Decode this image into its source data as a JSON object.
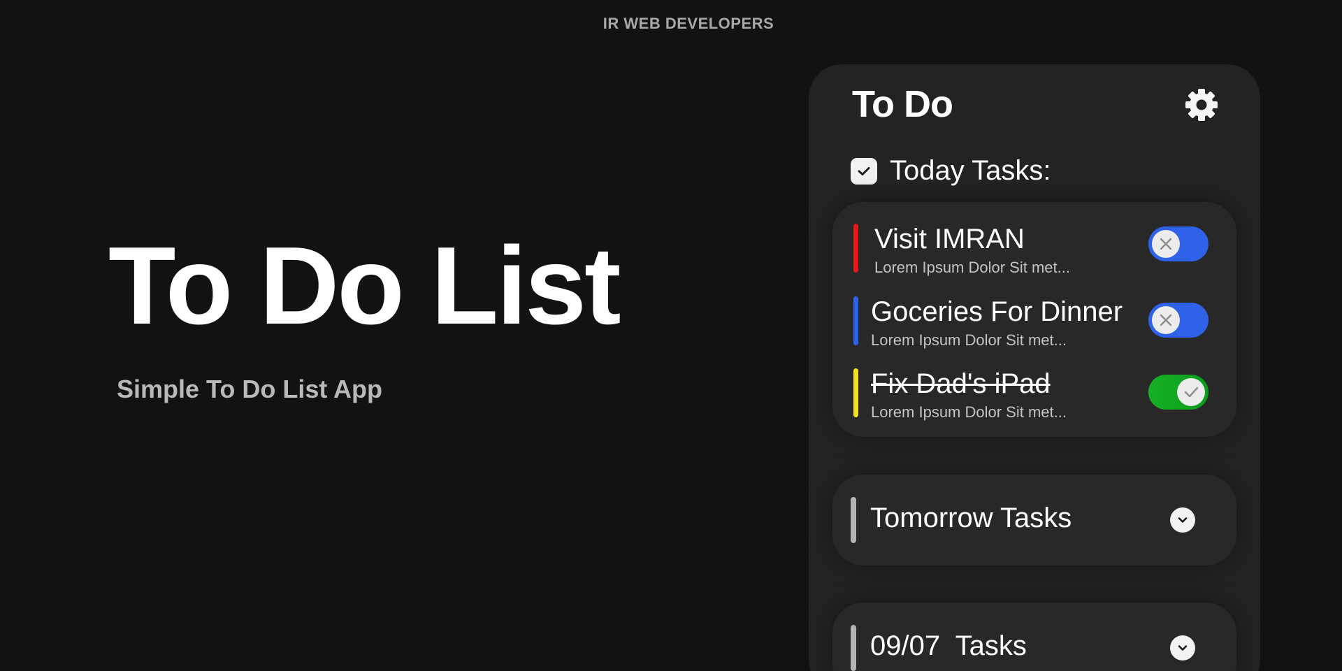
{
  "brand": "IR WEB DEVELOPERS",
  "hero": {
    "title": "To Do List",
    "subtitle": "Simple To Do List App"
  },
  "app": {
    "title": "To Do",
    "settings_icon": "gear-icon",
    "today": {
      "label": "Today Tasks:",
      "checked": true,
      "tasks": [
        {
          "title": "Visit IMRAN",
          "desc": "Lorem Ipsum Dolor Sit met...",
          "color": "#e81616",
          "done": false
        },
        {
          "title": "Goceries For Dinner",
          "desc": "Lorem Ipsum Dolor Sit met...",
          "color": "#2f62e8",
          "done": false
        },
        {
          "title": "Fix Dad's iPad",
          "desc": "Lorem Ipsum Dolor Sit met...",
          "color": "#f2e21d",
          "done": true
        }
      ]
    },
    "sections": [
      {
        "label": "Tomorrow Tasks",
        "collapsed": true
      },
      {
        "label": "09/07  Tasks",
        "collapsed": true
      }
    ]
  },
  "colors": {
    "background": "#121212",
    "card": "#232323",
    "toggle_off": "#2f62e8",
    "toggle_on": "#17b026"
  }
}
